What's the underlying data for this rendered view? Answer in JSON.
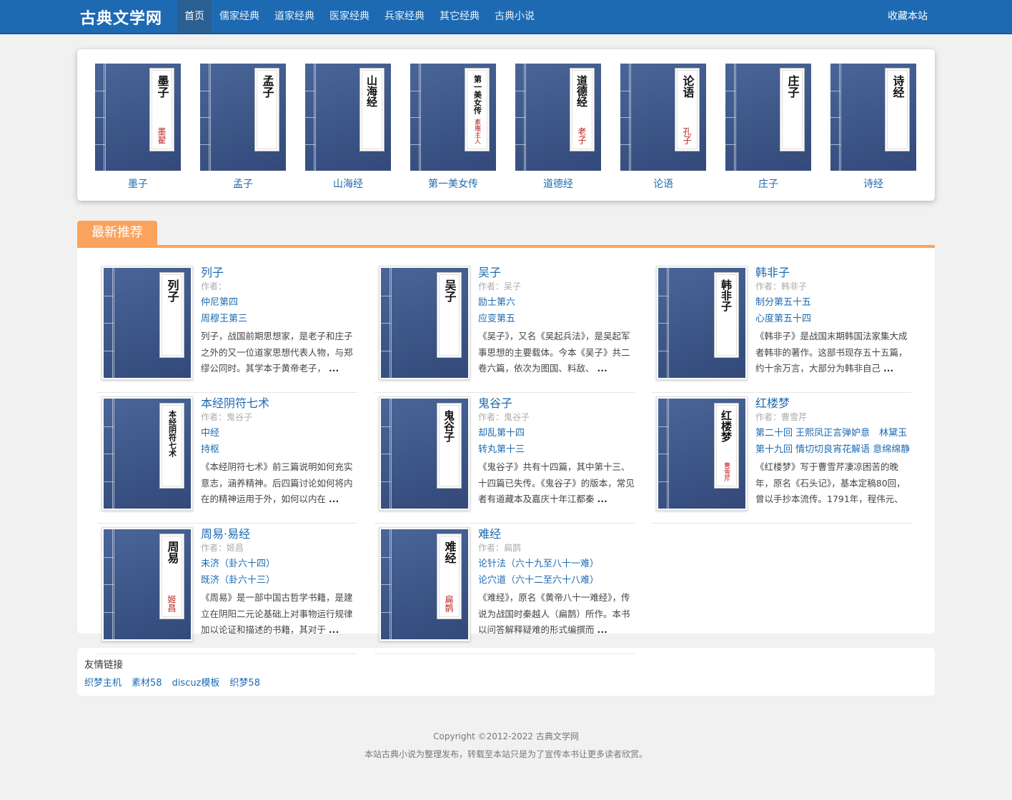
{
  "site": {
    "logo": "古典文学网",
    "favorite": "收藏本站"
  },
  "nav": [
    "首页",
    "儒家经典",
    "道家经典",
    "医家经典",
    "兵家经典",
    "其它经典",
    "古典小说"
  ],
  "slider": [
    {
      "title": "墨子",
      "cover_title": "墨子",
      "cover_author": "墨翟"
    },
    {
      "title": "孟子",
      "cover_title": "孟子",
      "cover_author": ""
    },
    {
      "title": "山海经",
      "cover_title": "山海经",
      "cover_author": ""
    },
    {
      "title": "第一美女传",
      "cover_title": "第一美女传",
      "cover_author": "素庵主人"
    },
    {
      "title": "道德经",
      "cover_title": "道德经",
      "cover_author": "老子"
    },
    {
      "title": "论语",
      "cover_title": "论语",
      "cover_author": "孔子"
    },
    {
      "title": "庄子",
      "cover_title": "庄子",
      "cover_author": ""
    },
    {
      "title": "诗经",
      "cover_title": "诗经",
      "cover_author": ""
    }
  ],
  "recommend": {
    "heading": "最新推荐",
    "items": [
      {
        "name": "列子",
        "author": "作者：",
        "cover_title": "列子",
        "cover_author": "",
        "ch1": "仲尼第四",
        "ch2": "周穆王第三",
        "desc": "列子，战国前期思想家，是老子和庄子之外的又一位道家思想代表人物，与郑缪公同时。其学本于黄帝老子，",
        "more": "..."
      },
      {
        "name": "吴子",
        "author": "作者：吴子",
        "cover_title": "吴子",
        "cover_author": "",
        "ch1": "励士第六",
        "ch2": "应变第五",
        "desc": "《吴子》，又名《吴起兵法》，是吴起军事思想的主要载体。今本《吴子》共二卷六篇，依次为图国、料敌、",
        "more": "..."
      },
      {
        "name": "韩非子",
        "author": "作者：韩非子",
        "cover_title": "韩非子",
        "cover_author": "",
        "ch1": "制分第五十五",
        "ch2": "心度第五十四",
        "desc": "《韩非子》是战国末期韩国法家集大成者韩非的著作。这部书现存五十五篇，约十余万言，大部分为韩非自己",
        "more": "..."
      },
      {
        "name": "本经阴符七术",
        "author": "作者：鬼谷子",
        "cover_title": "本经阴符七术",
        "cover_author": "",
        "ch1": "中经",
        "ch2": "持枢",
        "desc": "《本经阴符七术》前三篇说明如何充实意志，涵养精神。后四篇讨论如何将内在的精神运用于外，如何以内在",
        "more": "..."
      },
      {
        "name": "鬼谷子",
        "author": "作者：鬼谷子",
        "cover_title": "鬼谷子",
        "cover_author": "",
        "ch1": "却乱第十四",
        "ch2": "转丸第十三",
        "desc": "《鬼谷子》共有十四篇，其中第十三、十四篇已失传。《鬼谷子》的版本，常见者有道藏本及嘉庆十年江都秦",
        "more": "..."
      },
      {
        "name": "红楼梦",
        "author": "作者：曹雪芹",
        "cover_title": "红楼梦",
        "cover_author": "曹雪芹",
        "ch1": "第二十回 王熙凤正言弹妒意　林黛玉",
        "ch2": "第十九回 情切切良宵花解语 意绵绵静",
        "desc": "《红楼梦》写于曹雪芹凄凉困苦的晚年，原名《石头记》，基本定稿80回，曾以手抄本流传。1791年，程伟元、",
        "more": "..."
      },
      {
        "name": "周易·易经",
        "author": "作者：姬昌",
        "cover_title": "周易",
        "cover_author": "姬昌",
        "ch1": "未济（卦六十四）",
        "ch2": "既济（卦六十三）",
        "desc": "《周易》是一部中国古哲学书籍，是建立在阴阳二元论基础上对事物运行规律加以论证和描述的书籍，其对于",
        "more": "..."
      },
      {
        "name": "难经",
        "author": "作者：扁鹊",
        "cover_title": "难经",
        "cover_author": "扁鹊",
        "ch1": "论针法（六十九至八十一难）",
        "ch2": "论穴道（六十二至六十八难）",
        "desc": "《难经》，原名《黄帝八十一难经》，传说为战国时秦越人（扁鹊）所作。本书以问答解释疑难的形式编撰而",
        "more": "..."
      }
    ]
  },
  "links": {
    "title": "友情链接",
    "items": [
      "织梦主机",
      "素材58",
      "discuz模板",
      "织梦58"
    ]
  },
  "footer": {
    "copyright": "Copyright ©2012-2022 古典文学网",
    "note": "本站古典小说为整理发布，转载至本站只是为了宣传本书让更多读者欣赏。"
  }
}
